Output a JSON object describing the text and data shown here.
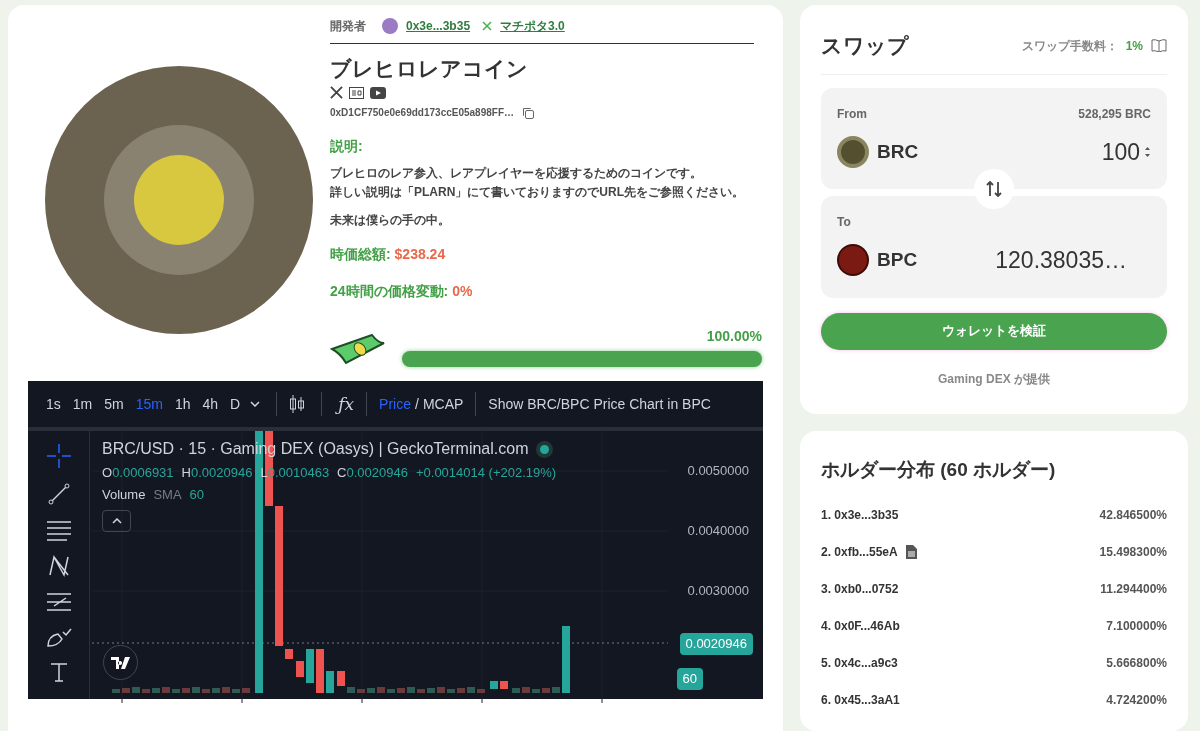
{
  "developer": {
    "label": "開発者",
    "address": "0x3e...3b35",
    "x_handle": "マチポタ3.0"
  },
  "token": {
    "name": "ブレヒロレアコイン",
    "contract": "0xD1CF750e0e69dd173ccE05a898FF…",
    "description_label": "説明:",
    "description": [
      [
        "ブレヒロのレア参入、レアプレイヤーを応援するためのコインです。",
        "詳しい説明は「PLARN」にて書いておりますのでURL先をご参照ください。"
      ],
      [
        "未来は僕らの手の中。"
      ]
    ],
    "market_cap_label": "時価総額:",
    "market_cap": "$238.24",
    "change_label": "24時間の価格変動:",
    "change": "0%"
  },
  "progress": {
    "reading": "100.00%",
    "level": 1
  },
  "chart": {
    "intervals": [
      {
        "label": "1s",
        "selected": false
      },
      {
        "label": "1m",
        "selected": false
      },
      {
        "label": "5m",
        "selected": false
      },
      {
        "label": "15m",
        "selected": true
      },
      {
        "label": "1h",
        "selected": false
      },
      {
        "label": "4h",
        "selected": false
      },
      {
        "label": "D",
        "selected": false
      }
    ],
    "price_toggle": [
      {
        "label": "Price",
        "selected": true
      },
      {
        "label": "MCAP",
        "selected": false
      }
    ],
    "separator": "/",
    "indicators_button": "ƒx",
    "pair_button": "Show BRC/BPC Price Chart in BPC",
    "title": "BRC/USD · 15 · Gaming DEX (Oasys) | GeckoTerminal.com",
    "ohlc": [
      {
        "key": "O",
        "value": "0.0006931"
      },
      {
        "key": "H",
        "value": "0.0020946"
      },
      {
        "key": "L",
        "value": "0.0010463"
      },
      {
        "key": "C",
        "value": "0.0020946"
      }
    ],
    "change": "+0.0014014 (+202.19%)",
    "volume_label": "Volume",
    "sma_label": "SMA",
    "sma_value": "60",
    "y_labels": [
      "0.0050000",
      "0.0040000",
      "0.0030000"
    ],
    "price_badge": "0.0020946",
    "volume_badge": "60"
  },
  "swap": {
    "title": "スワップ",
    "fee_label": "スワップ手数料：",
    "fee": "1%",
    "from": {
      "label": "From",
      "balance": "528,295 BRC",
      "token": "BRC",
      "amount": "100"
    },
    "to": {
      "label": "To",
      "token": "BPC",
      "amount": "120.38035…"
    },
    "button": "ウォレットを検証",
    "provider": "Gaming DEX が提供"
  },
  "holders": {
    "title": "ホルダー分布 (60 ホルダー)",
    "rows": [
      {
        "address": "1. 0x3e...3b35",
        "share": "42.846500%",
        "contract": false
      },
      {
        "address": "2. 0xfb...55eA",
        "share": "15.498300%",
        "contract": true
      },
      {
        "address": "3. 0xb0...0752",
        "share": "11.294400%",
        "contract": false
      },
      {
        "address": "4. 0x0F...46Ab",
        "share": "7.100000%",
        "contract": false
      },
      {
        "address": "5. 0x4c...a9c3",
        "share": "5.666800%",
        "contract": false
      },
      {
        "address": "6. 0x45...3aA1",
        "share": "4.724200%",
        "contract": false
      }
    ]
  }
}
